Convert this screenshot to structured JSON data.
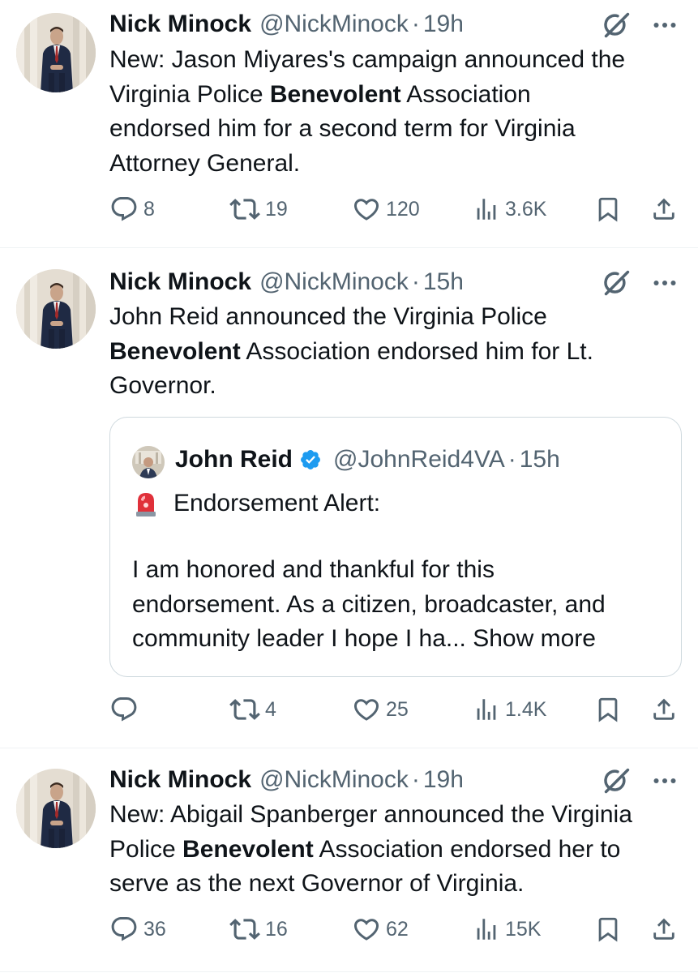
{
  "tweets": [
    {
      "author_name": "Nick Minock",
      "handle": "@NickMinock",
      "separator": "·",
      "time": "19h",
      "text_parts": [
        "New: Jason Miyares's campaign announced the",
        "Virginia Police ",
        "Benevolent",
        " Association",
        "endorsed him for a second term for Virginia",
        "Attorney General."
      ],
      "replies": "8",
      "reposts": "19",
      "likes": "120",
      "views": "3.6K"
    },
    {
      "author_name": "Nick Minock",
      "handle": "@NickMinock",
      "separator": "·",
      "time": "15h",
      "text_parts": [
        "John Reid announced the Virginia Police",
        "Benevolent",
        " Association endorsed him for Lt.",
        "Governor."
      ],
      "quote": {
        "author_name": "John Reid",
        "handle": "@JohnReid4VA",
        "separator": "·",
        "time": "15h",
        "line1": "Endorsement Alert:",
        "para_lines": [
          "I am honored and thankful for this",
          "endorsement. As a citizen, broadcaster, and",
          "community leader I hope I ha... "
        ],
        "show_more": "Show more"
      },
      "replies": "",
      "reposts": "4",
      "likes": "25",
      "views": "1.4K"
    },
    {
      "author_name": "Nick Minock",
      "handle": "@NickMinock",
      "separator": "·",
      "time": "19h",
      "text_parts": [
        "New: Abigail Spanberger announced the Virginia",
        "Police ",
        "Benevolent",
        " Association endorsed her to",
        "serve as the next Governor of Virginia."
      ],
      "replies": "36",
      "reposts": "16",
      "likes": "62",
      "views": "15K"
    }
  ],
  "icons": {
    "reply": "reply-icon",
    "repost": "repost-icon",
    "like": "like-icon",
    "views": "views-icon",
    "bookmark": "bookmark-icon",
    "share": "share-icon",
    "grok": "grok-icon",
    "more": "more-icon",
    "verified": "verified-badge-icon",
    "siren": "siren-emoji-icon"
  },
  "colors": {
    "text": "#0f1419",
    "secondary": "#536471",
    "border": "#cfd9de",
    "separator": "#eff3f4",
    "verified": "#1d9bf0"
  }
}
